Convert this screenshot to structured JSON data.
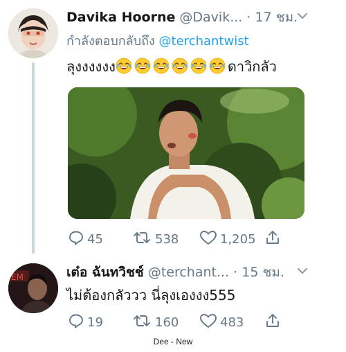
{
  "tweets": [
    {
      "name": "Davika Hoorne",
      "handle": "@Davik...",
      "dot": "·",
      "time": "17 ชม.",
      "replying_prefix": "กำลังตอบกลับถึง",
      "replying_to": "@terchantwist",
      "text_before": "ลุงงงงงง",
      "emoji_name": "face-with-tears-of-joy",
      "emoji_count": 6,
      "text_after": "ดาวิกลัว",
      "media_icon": "photo-of-man-outdoors",
      "reply_count": "45",
      "retweet_count": "538",
      "like_count": "1,205"
    },
    {
      "name": "เต๋อ ฉันทวิชช์",
      "handle": "@terchant...",
      "dot": "·",
      "time": "15 ชม.",
      "text": "ไม่ต้องกลัววว นี่ลุงเองงง555",
      "reply_count": "19",
      "retweet_count": "160",
      "like_count": "483"
    }
  ],
  "footer": "Dee - New",
  "colors": {
    "secondary": "#657786",
    "link": "#1da1f2",
    "text": "#14171a",
    "thread_line": "#ccd6dd"
  }
}
